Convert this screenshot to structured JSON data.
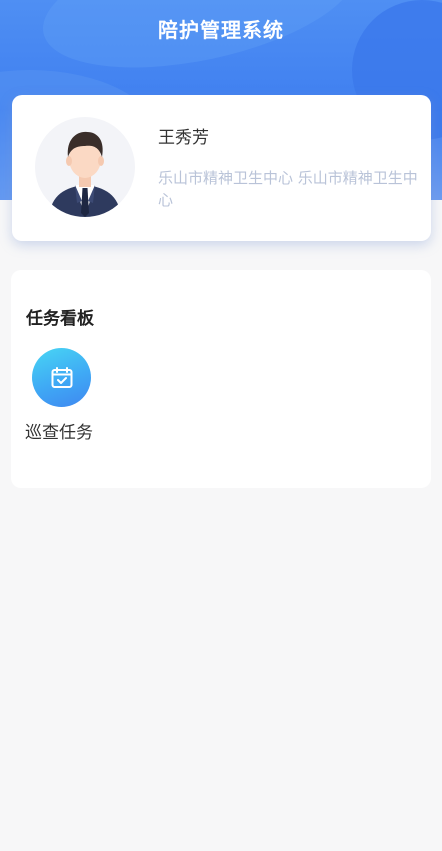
{
  "header": {
    "title": "陪护管理系统"
  },
  "profile": {
    "name": "王秀芳",
    "organization": "乐山市精神卫生中心 乐山市精神卫生中心"
  },
  "task_board": {
    "title": "任务看板",
    "items": [
      {
        "label": "巡查任务",
        "icon": "calendar-check-icon"
      }
    ]
  },
  "colors": {
    "header_gradient_top": "#4f8ff3",
    "header_gradient_bottom": "#6d9cf0",
    "org_text": "#b9c3d8",
    "task_icon_gradient": [
      "#48d6f3",
      "#3f87f0"
    ],
    "page_background": "#f7f7f8"
  }
}
